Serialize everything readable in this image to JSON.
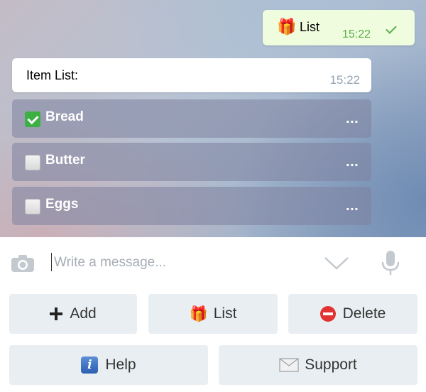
{
  "chat": {
    "outgoing": {
      "emoji": "🎁",
      "text": "List",
      "time": "15:22"
    },
    "incoming": {
      "text": "Item List:",
      "time": "15:22"
    },
    "items": [
      {
        "label": "Bread",
        "checked": true,
        "more": "..."
      },
      {
        "label": "Butter",
        "checked": false,
        "more": "..."
      },
      {
        "label": "Eggs",
        "checked": false,
        "more": "..."
      }
    ]
  },
  "composer": {
    "placeholder": "Write a message...",
    "value": "",
    "icons": [
      "camera-icon",
      "chevron-down-icon",
      "microphone-icon"
    ]
  },
  "keyboard": {
    "row1": [
      {
        "icon": "plus-icon",
        "label": "Add"
      },
      {
        "icon": "gift-icon",
        "emoji": "🎁",
        "label": "List"
      },
      {
        "icon": "no-entry-icon",
        "label": "Delete"
      }
    ],
    "row2": [
      {
        "icon": "info-icon",
        "glyph": "i",
        "label": "Help"
      },
      {
        "icon": "envelope-icon",
        "label": "Support"
      }
    ]
  },
  "colors": {
    "outgoing_bubble": "#effdde",
    "outgoing_time": "#5dac4b",
    "incoming_time": "#94a3b3",
    "inline_button": "#7d829e",
    "keyboard_button": "#e9eef2",
    "checked_box": "#3cb043",
    "delete_icon": "#e23232"
  }
}
